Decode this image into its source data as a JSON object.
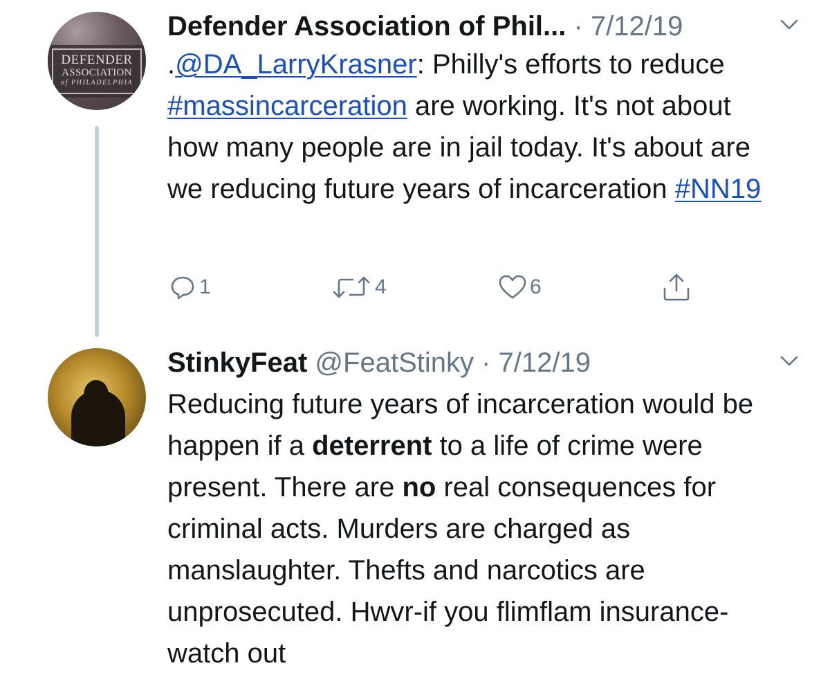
{
  "tweet1": {
    "avatar": {
      "line1": "DEFENDER",
      "line2": "ASSOCIATION",
      "line3": "of PHILADELPHIA"
    },
    "name": "Defender Association of Phil...",
    "separator": " · ",
    "date": "7/12/19",
    "menu_icon": "chevron-down-icon",
    "text": {
      "prefix": ".",
      "mention": "@DA_LarryKrasner",
      "part1": ": Philly's efforts to reduce ",
      "hashtag1": "#massincarceration",
      "part2": " are working. It's not about how many people are in jail today. It's about are we reducing future years of incarceration ",
      "hashtag2": "#NN19"
    },
    "actions": {
      "reply_count": "1",
      "retweet_count": "4",
      "like_count": "6"
    }
  },
  "tweet2": {
    "name": "StinkyFeat",
    "handle": "@FeatStinky",
    "separator": " · ",
    "date": "7/12/19",
    "menu_icon": "chevron-down-icon",
    "text": {
      "part1": "Reducing future years of incarceration would be happen if a ",
      "bold1": "deterrent",
      "part2": " to a life of crime were present. There are ",
      "bold2": "no",
      "part3": " real consequences for criminal acts. Murders are charged as manslaughter. Thefts and narcotics are unprosecuted. Hwvr-if you flimflam insurance- watch out"
    }
  },
  "colors": {
    "text": "#14171a",
    "secondary": "#657786",
    "link": "#1b4fbf",
    "thread_line": "#c4cfd6"
  }
}
